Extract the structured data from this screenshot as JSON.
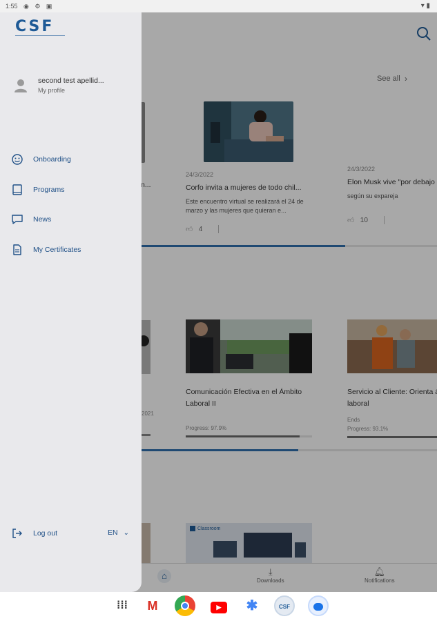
{
  "status_bar": {
    "time": "1:55",
    "icons": [
      "notification-icon",
      "settings-icon",
      "download-icon"
    ],
    "right_icons": [
      "wifi-icon",
      "battery-icon"
    ]
  },
  "app": {
    "see_all_label": "See all",
    "news": [
      {
        "date": "",
        "title": "n...",
        "excerpt": "",
        "likes": ""
      },
      {
        "date": "24/3/2022",
        "title": "Corfo invita a mujeres de todo chil...",
        "excerpt": "Este encuentro virtual se realizará el 24 de marzo y las mujeres que quieran e...",
        "likes": "4"
      },
      {
        "date": "24/3/2022",
        "title": "Elon Musk vive \"por debajo",
        "excerpt": "según su expareja",
        "likes": "10"
      }
    ],
    "programs": [
      {
        "title": "Comunicación Efectiva en el Ámbito Laboral II",
        "sub": "",
        "progress_label": "Progress: 97.9%",
        "progress": 0.9
      },
      {
        "title": "Servicio al Cliente: Orienta ámbito laboral",
        "sub": "Ends",
        "progress_label": "Progress: 93.1%",
        "progress": 1.0
      }
    ],
    "partial_program_date": "2021",
    "classroom_label": "Classroom",
    "bottom_nav": {
      "home": "",
      "downloads": "Downloads",
      "notifications": "Notifications"
    }
  },
  "drawer": {
    "logo_text": "CSF",
    "user_name": "second test apellid...",
    "user_subtitle": "My profile",
    "menu": [
      {
        "label": "Onboarding",
        "icon": "smiley-icon"
      },
      {
        "label": "Programs",
        "icon": "book-icon"
      },
      {
        "label": "News",
        "icon": "chat-icon"
      },
      {
        "label": "My Certificates",
        "icon": "document-icon"
      }
    ],
    "logout_label": "Log out",
    "language": "EN"
  },
  "dock": [
    "apps-grid-icon",
    "gmail-icon",
    "chrome-icon",
    "youtube-icon",
    "photos-icon",
    "csf-app-icon",
    "messages-icon"
  ],
  "dock_csf_label": "CSF",
  "colors": {
    "brand_blue": "#1e5a96",
    "drawer_bg": "#e9e9ec",
    "scrim": "rgba(0,0,0,0.34)"
  }
}
